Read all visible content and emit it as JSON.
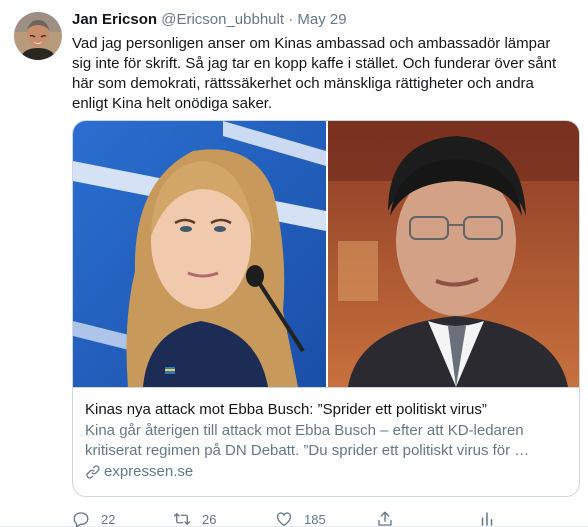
{
  "tweet": {
    "author": {
      "display_name": "Jan Ericson",
      "handle": "@Ericson_ubbhult",
      "separator": "·",
      "date": "May 29"
    },
    "text": "Vad jag personligen anser om Kinas ambassad och ambassadör lämpar sig inte för skrift. Så jag tar en kopp kaffe i stället. Och funderar över sånt här som demokrati, rättssäkerhet och mänskliga rättigheter och andra enligt Kina helt onödiga saker.",
    "card": {
      "title": "Kinas nya attack mot Ebba Busch: ”Sprider ett politiskt virus”",
      "description": "Kina går återigen till attack mot Ebba Busch – efter att KD-ledaren kritiserat regimen på DN Debatt. ”Du sprider ett politiskt virus för …",
      "domain": "expressen.se",
      "link_icon": "link-icon"
    },
    "actions": {
      "reply_count": "22",
      "retweet_count": "26",
      "like_count": "185",
      "icons": [
        "reply-icon",
        "retweet-icon",
        "like-icon",
        "share-icon",
        "analytics-icon"
      ]
    },
    "colors": {
      "secondary_text": "#657786",
      "primary_text": "#14171a",
      "border": "#ccd6dd"
    }
  }
}
